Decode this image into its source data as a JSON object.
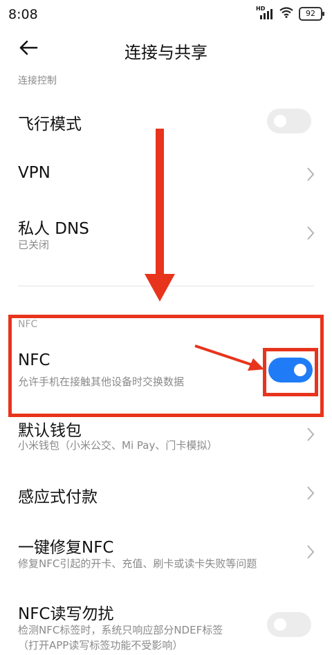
{
  "status": {
    "time": "8:08",
    "battery": "92",
    "network": "HD"
  },
  "header": {
    "title": "连接与共享"
  },
  "sections": {
    "connection_control": "连接控制",
    "nfc": "NFC"
  },
  "items": {
    "airplane": {
      "title": "飞行模式",
      "toggle_on": false
    },
    "vpn": {
      "title": "VPN"
    },
    "private_dns": {
      "title": "私人 DNS",
      "subtitle": "已关闭"
    },
    "nfc": {
      "title": "NFC",
      "subtitle": "允许手机在接触其他设备时交换数据",
      "toggle_on": true
    },
    "default_wallet": {
      "title": "默认钱包",
      "subtitle": "小米钱包（小米公交、Mi Pay、门卡模拟）"
    },
    "tap_pay": {
      "title": "感应式付款"
    },
    "repair_nfc": {
      "title": "一键修复NFC",
      "subtitle": "修复NFC引起的开卡、充值、刷卡或读卡失败等问题"
    },
    "nfc_dnd": {
      "title": "NFC读写勿扰",
      "subtitle_line1": "检测NFC标签时，系统只响应部分NDEF标签",
      "subtitle_line2": "（打开APP读写标签功能不受影响）",
      "toggle_on": false
    }
  },
  "colors": {
    "annotation": "#e8341c",
    "toggle_on": "#1f7cf6",
    "toggle_off": "#ececec"
  }
}
